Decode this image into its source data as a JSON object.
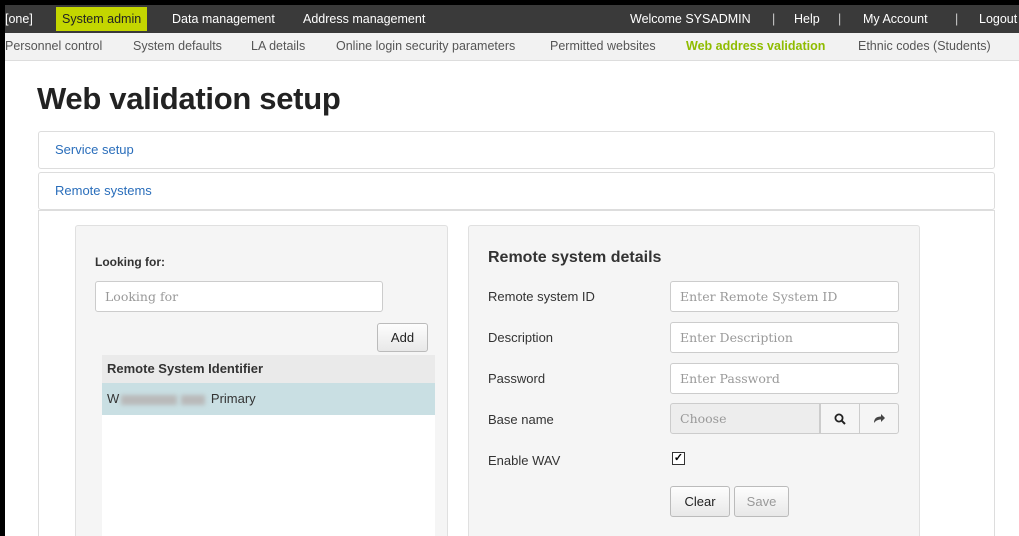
{
  "topnav": {
    "org": "[one]",
    "system_admin": "System admin",
    "data_management": "Data management",
    "address_management": "Address management",
    "welcome": "Welcome SYSADMIN",
    "help": "Help",
    "my_account": "My Account",
    "logout": "Logout",
    "separator": "|"
  },
  "subnav": {
    "items": [
      "Personnel control",
      "System defaults",
      "LA details",
      "Online login security parameters",
      "Permitted websites",
      "Web address validation",
      "Ethnic codes (Students)"
    ],
    "active_index": 5
  },
  "page": {
    "title": "Web validation setup"
  },
  "panels": {
    "service_setup": "Service setup",
    "remote_systems": "Remote systems"
  },
  "left": {
    "looking_for_label": "Looking for:",
    "looking_for_placeholder": "Looking for",
    "add_label": "Add",
    "table_header": "Remote System Identifier",
    "rows": [
      {
        "prefix": "W",
        "suffix": "Primary",
        "selected": true
      }
    ]
  },
  "right": {
    "title": "Remote system details",
    "fields": {
      "remote_system_id": {
        "label": "Remote system ID",
        "placeholder": "Enter Remote System ID"
      },
      "description": {
        "label": "Description",
        "placeholder": "Enter Description"
      },
      "password": {
        "label": "Password",
        "placeholder": "Enter Password"
      },
      "base_name": {
        "label": "Base name",
        "placeholder": "Choose"
      },
      "enable_wav": {
        "label": "Enable WAV",
        "checked": true,
        "check_glyph": "✓"
      }
    },
    "clear_label": "Clear",
    "save_label": "Save"
  },
  "colors": {
    "accent": "#c4d600",
    "active_tab": "#8fbc00",
    "link": "#2a6ebb",
    "selected_row": "#c9dfe3",
    "topbar": "#3a3a3a"
  },
  "icons": {
    "search": "search-icon",
    "go": "share-arrow-icon",
    "checkbox": "checkmark-icon"
  }
}
